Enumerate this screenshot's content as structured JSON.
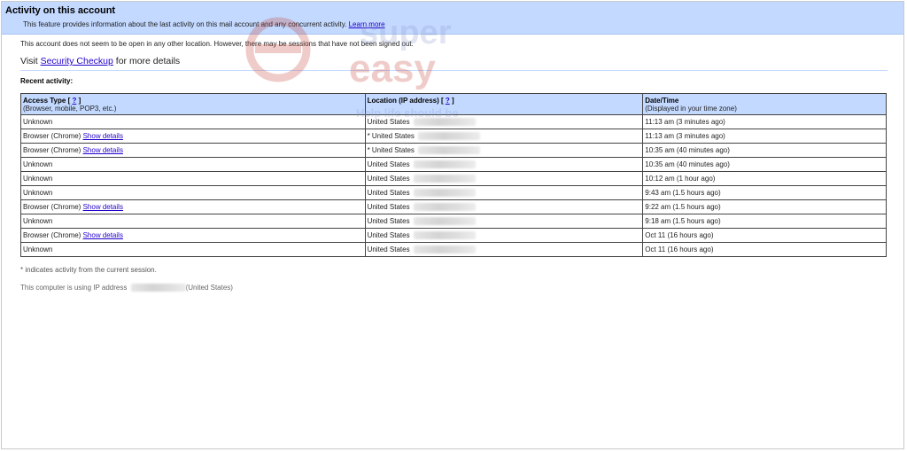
{
  "header": {
    "title": "Activity on this account",
    "description": "This feature provides information about the last activity on this mail account and any concurrent activity.",
    "learn_more": "Learn more"
  },
  "status_text": "This account does not seem to be open in any other location. However, there may be sessions that have not been signed out.",
  "visit": {
    "prefix": "Visit",
    "link": "Security Checkup",
    "suffix": "for more details"
  },
  "recent_label": "Recent activity:",
  "table": {
    "columns": [
      {
        "title": "Access Type",
        "help": "?",
        "subtitle": "(Browser, mobile, POP3, etc.)"
      },
      {
        "title": "Location (IP address)",
        "help": "?",
        "subtitle": ""
      },
      {
        "title": "Date/Time",
        "help": "",
        "subtitle": "(Displayed in your time zone)"
      }
    ],
    "show_details_label": "Show details",
    "rows": [
      {
        "access": "Unknown",
        "details": false,
        "location": "United States",
        "current": false,
        "time": "11:13 am (3 minutes ago)"
      },
      {
        "access": "Browser (Chrome)",
        "details": true,
        "location": "United States",
        "current": true,
        "time": "11:13 am (3 minutes ago)"
      },
      {
        "access": "Browser (Chrome)",
        "details": true,
        "location": "United States",
        "current": true,
        "time": "10:35 am (40 minutes ago)"
      },
      {
        "access": "Unknown",
        "details": false,
        "location": "United States",
        "current": false,
        "time": "10:35 am (40 minutes ago)"
      },
      {
        "access": "Unknown",
        "details": false,
        "location": "United States",
        "current": false,
        "time": "10:12 am (1 hour ago)"
      },
      {
        "access": "Unknown",
        "details": false,
        "location": "United States",
        "current": false,
        "time": "9:43 am (1.5 hours ago)"
      },
      {
        "access": "Browser (Chrome)",
        "details": true,
        "location": "United States",
        "current": false,
        "time": "9:22 am (1.5 hours ago)"
      },
      {
        "access": "Unknown",
        "details": false,
        "location": "United States",
        "current": false,
        "time": "9:18 am (1.5 hours ago)"
      },
      {
        "access": "Browser (Chrome)",
        "details": true,
        "location": "United States",
        "current": false,
        "time": "Oct 11 (16 hours ago)"
      },
      {
        "access": "Unknown",
        "details": false,
        "location": "United States",
        "current": false,
        "time": "Oct 11 (16 hours ago)"
      }
    ]
  },
  "footnote": "* indicates activity from the current session.",
  "ip_line": {
    "prefix": "This computer is using IP address",
    "suffix": "(United States)"
  },
  "watermark": {
    "line1": "super",
    "line2": "easy",
    "line3": "Help life should be"
  }
}
